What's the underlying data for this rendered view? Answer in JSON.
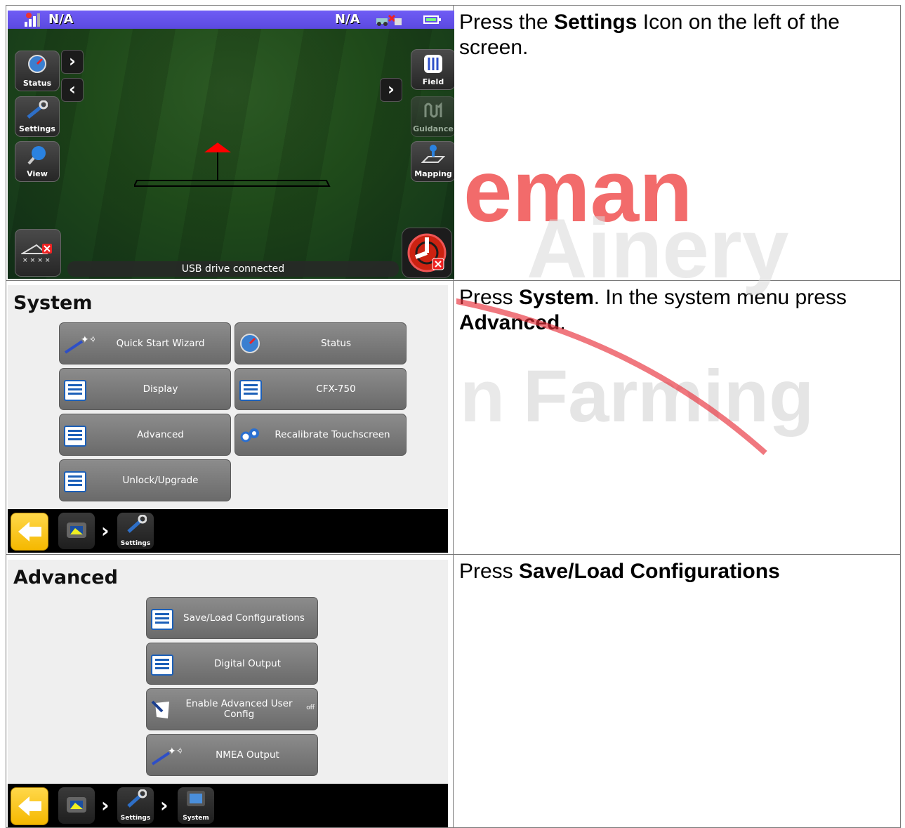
{
  "rows": [
    {
      "instruction": {
        "pre": "Press the ",
        "bold": "Settings",
        "post": " Icon on the left of the screen."
      }
    },
    {
      "instruction": {
        "pre": "Press ",
        "bold": "System",
        "mid": ". In the system menu press ",
        "bold2": "Advanced",
        "post": "."
      }
    },
    {
      "instruction": {
        "pre": "Press ",
        "bold": "Save",
        "mid": "/",
        "bold2": "Load Configurations",
        "post": ""
      }
    }
  ],
  "guidance_screen": {
    "top_left_status": "N/A",
    "top_right_status": "N/A",
    "left_buttons": [
      "Status",
      "Settings",
      "View"
    ],
    "right_buttons": [
      "Field",
      "Guidance",
      "Mapping"
    ],
    "status_message": "USB drive connected"
  },
  "system_screen": {
    "title": "System",
    "buttons": [
      "Quick Start Wizard",
      "Status",
      "Display",
      "CFX-750",
      "Advanced",
      "Recalibrate Touchscreen",
      "Unlock/Upgrade"
    ],
    "breadcrumb": [
      "Settings"
    ]
  },
  "advanced_screen": {
    "title": "Advanced",
    "buttons": [
      "Save/Load Configurations",
      "Digital Output",
      "Enable Advanced User Config",
      "NMEA Output"
    ],
    "toggle_value": "off",
    "breadcrumb": [
      "Settings",
      "System"
    ]
  },
  "watermark": {
    "word1": "eman",
    "word2": "Farming"
  },
  "colors": {
    "accent": "#5b49e0",
    "back_button": "#f5b800",
    "menu_button": "#7a7a7a",
    "watermark": "#e8303a"
  }
}
